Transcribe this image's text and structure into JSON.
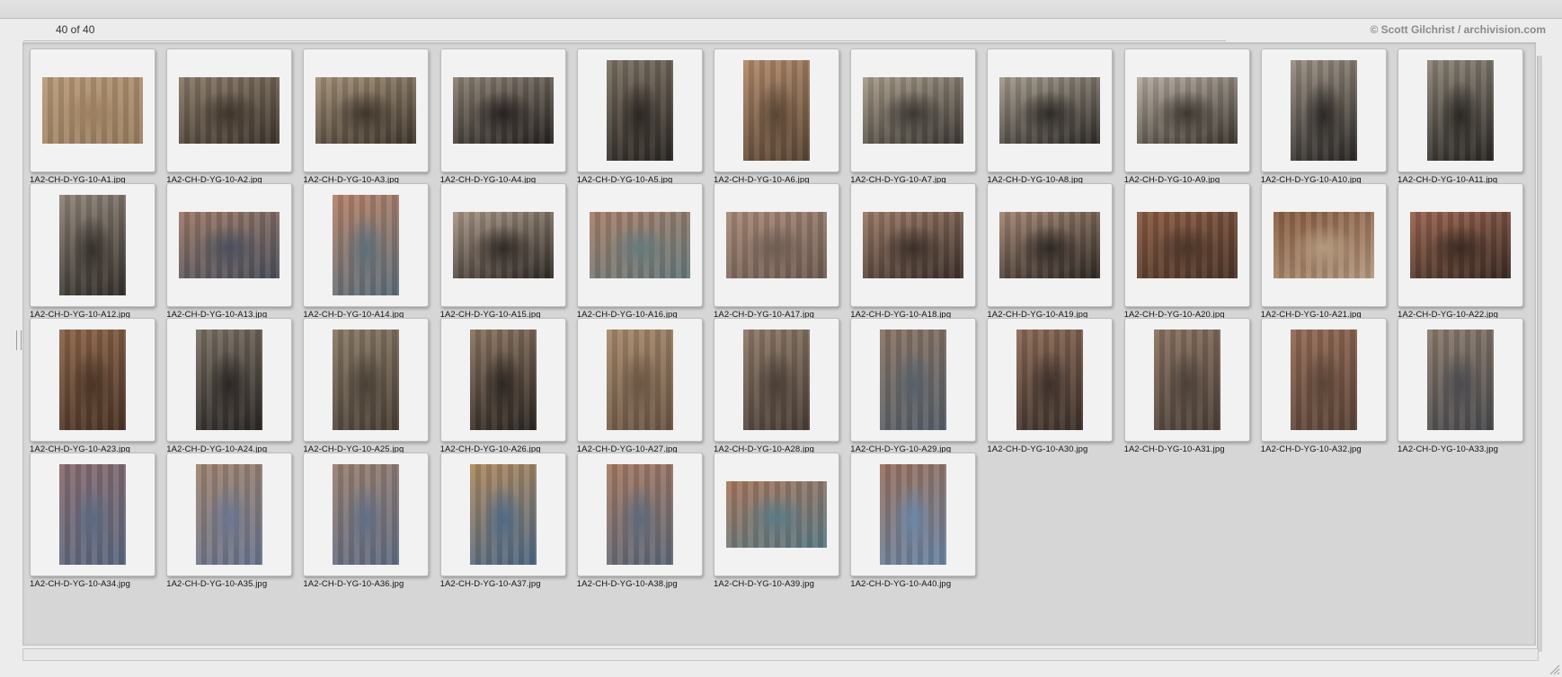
{
  "header": {
    "count_text": "40 of 40",
    "credit_text": "© Scott Gilchrist / archivision.com"
  },
  "thumbnails": [
    {
      "filename": "1A2-CH-D-YG-10-A1.jpg",
      "orientation": "landscape",
      "colors": [
        "#b89a78",
        "#9c7f60"
      ]
    },
    {
      "filename": "1A2-CH-D-YG-10-A2.jpg",
      "orientation": "landscape",
      "colors": [
        "#8a7a68",
        "#3e352c"
      ]
    },
    {
      "filename": "1A2-CH-D-YG-10-A3.jpg",
      "orientation": "landscape",
      "colors": [
        "#a39078",
        "#3f362c"
      ]
    },
    {
      "filename": "1A2-CH-D-YG-10-A4.jpg",
      "orientation": "landscape",
      "colors": [
        "#8c8174",
        "#262220"
      ]
    },
    {
      "filename": "1A2-CH-D-YG-10-A5.jpg",
      "orientation": "portrait",
      "colors": [
        "#7d7264",
        "#2a2622"
      ]
    },
    {
      "filename": "1A2-CH-D-YG-10-A6.jpg",
      "orientation": "portrait",
      "colors": [
        "#b18a6b",
        "#5a4634"
      ]
    },
    {
      "filename": "1A2-CH-D-YG-10-A7.jpg",
      "orientation": "landscape",
      "colors": [
        "#a89c8a",
        "#3c3834"
      ]
    },
    {
      "filename": "1A2-CH-D-YG-10-A8.jpg",
      "orientation": "landscape",
      "colors": [
        "#a39a8c",
        "#2f2b28"
      ]
    },
    {
      "filename": "1A2-CH-D-YG-10-A9.jpg",
      "orientation": "landscape",
      "colors": [
        "#b5aca0",
        "#3e3730"
      ]
    },
    {
      "filename": "1A2-CH-D-YG-10-A10.jpg",
      "orientation": "portrait",
      "colors": [
        "#9a8f82",
        "#2b2826"
      ]
    },
    {
      "filename": "1A2-CH-D-YG-10-A11.jpg",
      "orientation": "portrait",
      "colors": [
        "#8e8578",
        "#2a2724"
      ]
    },
    {
      "filename": "1A2-CH-D-YG-10-A12.jpg",
      "orientation": "portrait",
      "colors": [
        "#8f8478",
        "#35302c"
      ]
    },
    {
      "filename": "1A2-CH-D-YG-10-A13.jpg",
      "orientation": "landscape",
      "colors": [
        "#9c7a68",
        "#4a4f5c"
      ]
    },
    {
      "filename": "1A2-CH-D-YG-10-A14.jpg",
      "orientation": "portrait",
      "colors": [
        "#b8826a",
        "#5c6f7a"
      ]
    },
    {
      "filename": "1A2-CH-D-YG-10-A15.jpg",
      "orientation": "landscape",
      "colors": [
        "#a89686",
        "#302a26"
      ]
    },
    {
      "filename": "1A2-CH-D-YG-10-A16.jpg",
      "orientation": "landscape",
      "colors": [
        "#a8806a",
        "#667a7c"
      ]
    },
    {
      "filename": "1A2-CH-D-YG-10-A17.jpg",
      "orientation": "landscape",
      "colors": [
        "#a88a78",
        "#6e5c52"
      ]
    },
    {
      "filename": "1A2-CH-D-YG-10-A18.jpg",
      "orientation": "landscape",
      "colors": [
        "#9a7a66",
        "#3c302a"
      ]
    },
    {
      "filename": "1A2-CH-D-YG-10-A19.jpg",
      "orientation": "landscape",
      "colors": [
        "#a28672",
        "#2e2824"
      ]
    },
    {
      "filename": "1A2-CH-D-YG-10-A20.jpg",
      "orientation": "landscape",
      "colors": [
        "#8c5c44",
        "#4a3428"
      ]
    },
    {
      "filename": "1A2-CH-D-YG-10-A21.jpg",
      "orientation": "landscape",
      "colors": [
        "#8a5e42",
        "#b49a80"
      ]
    },
    {
      "filename": "1A2-CH-D-YG-10-A22.jpg",
      "orientation": "landscape",
      "colors": [
        "#9a6450",
        "#3a2a22"
      ]
    },
    {
      "filename": "1A2-CH-D-YG-10-A23.jpg",
      "orientation": "portrait",
      "colors": [
        "#8c6448",
        "#4a3426"
      ]
    },
    {
      "filename": "1A2-CH-D-YG-10-A24.jpg",
      "orientation": "portrait",
      "colors": [
        "#7a7064",
        "#2a2624"
      ]
    },
    {
      "filename": "1A2-CH-D-YG-10-A25.jpg",
      "orientation": "portrait",
      "colors": [
        "#8a7a66",
        "#4a4036"
      ]
    },
    {
      "filename": "1A2-CH-D-YG-10-A26.jpg",
      "orientation": "portrait",
      "colors": [
        "#8a7460",
        "#2c2622"
      ]
    },
    {
      "filename": "1A2-CH-D-YG-10-A27.jpg",
      "orientation": "portrait",
      "colors": [
        "#a88a6c",
        "#6a5644"
      ]
    },
    {
      "filename": "1A2-CH-D-YG-10-A28.jpg",
      "orientation": "portrait",
      "colors": [
        "#8e7a68",
        "#4a3e36"
      ]
    },
    {
      "filename": "1A2-CH-D-YG-10-A29.jpg",
      "orientation": "portrait",
      "colors": [
        "#8a7464",
        "#56606a"
      ]
    },
    {
      "filename": "1A2-CH-D-YG-10-A30.jpg",
      "orientation": "portrait",
      "colors": [
        "#8c6a56",
        "#3c302a"
      ]
    },
    {
      "filename": "1A2-CH-D-YG-10-A31.jpg",
      "orientation": "portrait",
      "colors": [
        "#8a7260",
        "#4c4038"
      ]
    },
    {
      "filename": "1A2-CH-D-YG-10-A32.jpg",
      "orientation": "portrait",
      "colors": [
        "#946a54",
        "#5a4438"
      ]
    },
    {
      "filename": "1A2-CH-D-YG-10-A33.jpg",
      "orientation": "portrait",
      "colors": [
        "#8a7a6c",
        "#4a4a4e"
      ]
    },
    {
      "filename": "1A2-CH-D-YG-10-A34.jpg",
      "orientation": "portrait",
      "colors": [
        "#8a6c70",
        "#5c6a82"
      ]
    },
    {
      "filename": "1A2-CH-D-YG-10-A35.jpg",
      "orientation": "portrait",
      "colors": [
        "#a08470",
        "#6a7690"
      ]
    },
    {
      "filename": "1A2-CH-D-YG-10-A36.jpg",
      "orientation": "portrait",
      "colors": [
        "#9a8070",
        "#626e86"
      ]
    },
    {
      "filename": "1A2-CH-D-YG-10-A37.jpg",
      "orientation": "portrait",
      "colors": [
        "#b08a60",
        "#4e6a86"
      ]
    },
    {
      "filename": "1A2-CH-D-YG-10-A38.jpg",
      "orientation": "portrait",
      "colors": [
        "#a87a64",
        "#5e6a7a"
      ]
    },
    {
      "filename": "1A2-CH-D-YG-10-A39.jpg",
      "orientation": "landscape",
      "colors": [
        "#a8785e",
        "#5a7a86"
      ]
    },
    {
      "filename": "1A2-CH-D-YG-10-A40.jpg",
      "orientation": "portrait",
      "colors": [
        "#9a7260",
        "#6a86a6"
      ]
    }
  ]
}
